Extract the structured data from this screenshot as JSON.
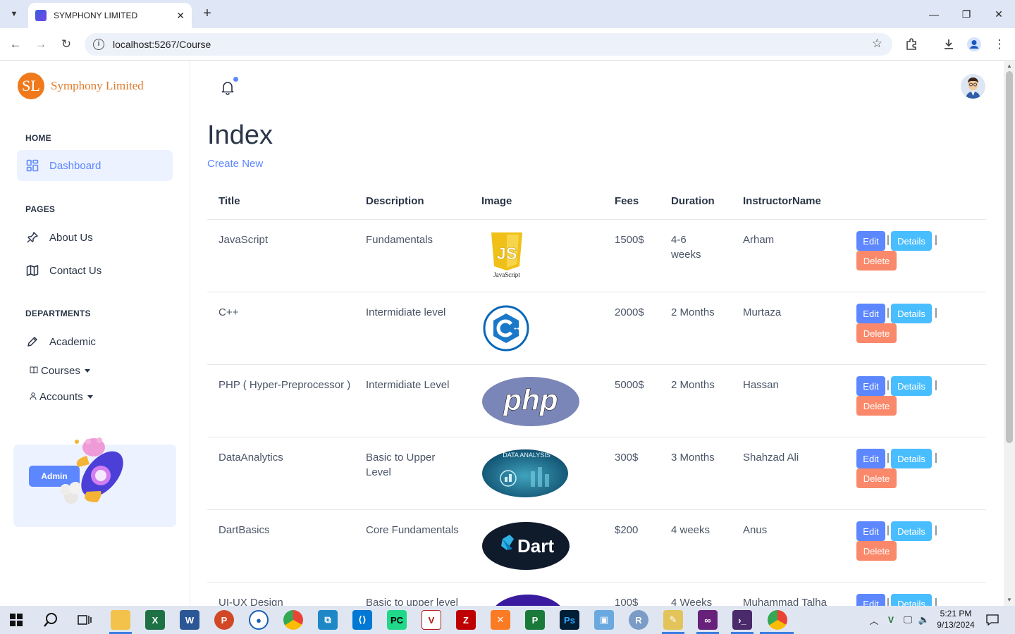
{
  "browser": {
    "tab_title": "SYMPHONY LIMITED",
    "url": "localhost:5267/Course"
  },
  "sidebar": {
    "logo_mark": "SL",
    "logo_text": "Symphony Limited",
    "sections": [
      {
        "caption": "HOME"
      },
      {
        "caption": "PAGES"
      },
      {
        "caption": "DEPARTMENTS"
      }
    ],
    "items": [
      {
        "label": "Dashboard"
      },
      {
        "label": "About Us"
      },
      {
        "label": "Contact Us"
      },
      {
        "label": "Academic"
      }
    ],
    "dropdowns": [
      {
        "label": "Courses"
      },
      {
        "label": "Accounts"
      }
    ],
    "promo_button": "Admin"
  },
  "main": {
    "heading": "Index",
    "create_link": "Create New",
    "columns": [
      "Title",
      "Description",
      "Image",
      "Fees",
      "Duration",
      "InstructorName"
    ],
    "rows": [
      {
        "title": "JavaScript",
        "description": "Fundamentals",
        "image": "JavaScript logo",
        "fees": "1500$",
        "duration": "4-6 weeks",
        "instructor": "Arham"
      },
      {
        "title": "C++",
        "description": "Intermidiate level",
        "image": "C++ logo",
        "fees": "2000$",
        "duration": "2 Months",
        "instructor": "Murtaza"
      },
      {
        "title": "PHP ( Hyper-Preprocessor )",
        "description": "Intermidiate Level",
        "image": "PHP logo",
        "fees": "5000$",
        "duration": "2 Months",
        "instructor": "Hassan"
      },
      {
        "title": "DataAnalytics",
        "description": "Basic to Upper Level",
        "image": "Data analysis image",
        "fees": "300$",
        "duration": "3 Months",
        "instructor": "Shahzad Ali"
      },
      {
        "title": "DartBasics",
        "description": "Core Fundamentals",
        "image": "Dart logo",
        "fees": "$200",
        "duration": "4 weeks",
        "instructor": "Anus"
      },
      {
        "title": "UI-UX Design",
        "description": "Basic to upper level",
        "image": "UI-UX image",
        "fees": "100$",
        "duration": "4 Weeks",
        "instructor": "Muhammad Talha"
      }
    ],
    "actions": {
      "edit": "Edit",
      "details": "Details",
      "delete": "Delete",
      "separator": "|"
    },
    "image_texts": {
      "js": "JS",
      "js_caption": "JavaScript",
      "php": "php",
      "data": "DATA ANALYSIS",
      "dart": "Dart"
    }
  },
  "taskbar": {
    "time": "5:21 PM",
    "date": "9/13/2024"
  },
  "colors": {
    "primary": "#5d87ff",
    "info": "#49beff",
    "danger": "#fa896b",
    "brand": "#f07a1b"
  }
}
